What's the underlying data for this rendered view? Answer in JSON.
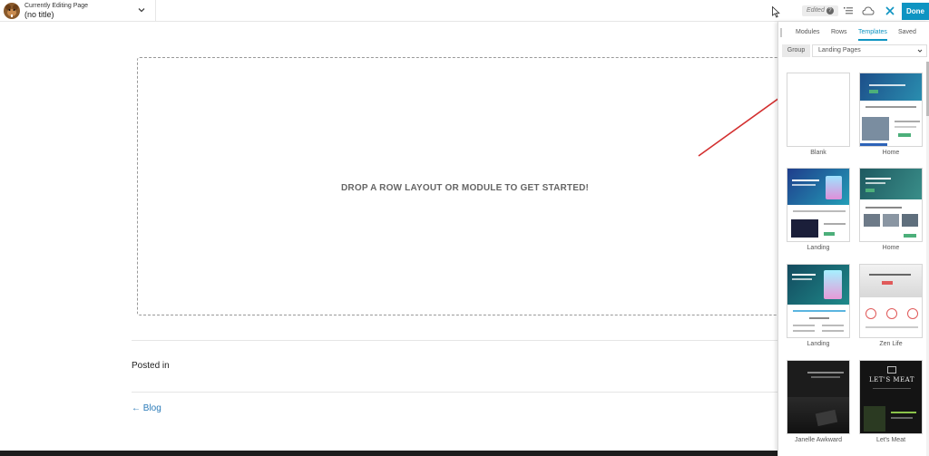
{
  "topbar": {
    "editing_label": "Currently Editing Page",
    "page_title": "(no title)",
    "edited_label": "Edited",
    "help_glyph": "?",
    "done_label": "Done",
    "icons": [
      "chevron-down-icon",
      "outline-icon",
      "cloud-icon",
      "close-icon"
    ]
  },
  "canvas": {
    "drop_text": "DROP A ROW LAYOUT OR MODULE TO GET STARTED!",
    "posted_in": "Posted in",
    "back_link": "← Blog"
  },
  "panel": {
    "tabs": [
      {
        "label": "Modules"
      },
      {
        "label": "Rows"
      },
      {
        "label": "Templates",
        "active": true
      },
      {
        "label": "Saved"
      }
    ],
    "group_label": "Group",
    "group_value": "Landing Pages",
    "templates": [
      {
        "name": "Blank"
      },
      {
        "name": "Home"
      },
      {
        "name": "Landing"
      },
      {
        "name": "Home"
      },
      {
        "name": "Landing"
      },
      {
        "name": "Zen Life"
      },
      {
        "name": "Janelle Awkward"
      },
      {
        "name": "Let's Meat"
      }
    ],
    "thumb_text": {
      "letsmeat_title": "LET'S MEAT"
    }
  },
  "colors": {
    "accent": "#0e94c2",
    "arrow": "#d32f2f"
  }
}
